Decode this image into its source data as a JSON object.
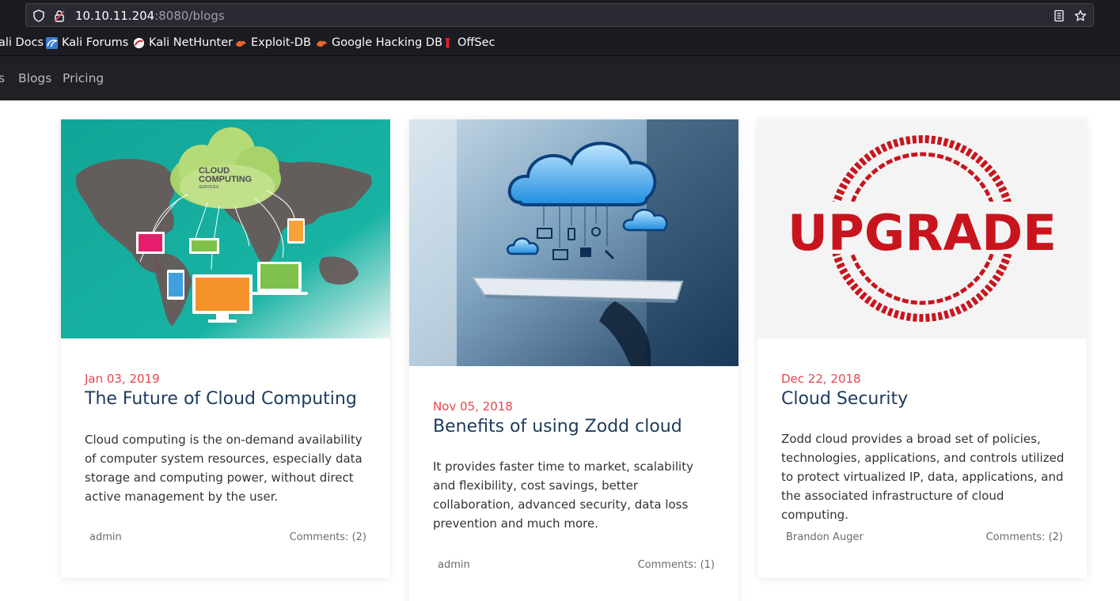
{
  "browser": {
    "url_host": "10.10.11.204",
    "url_path": ":8080/blogs",
    "bookmarks": [
      {
        "label": "ali Docs",
        "icon": "kali-icon"
      },
      {
        "label": "Kali Forums",
        "icon": "kali-icon"
      },
      {
        "label": "Kali NetHunter",
        "icon": "nethunter-icon"
      },
      {
        "label": "Exploit-DB",
        "icon": "exploitdb-icon"
      },
      {
        "label": "Google Hacking DB",
        "icon": "exploitdb-icon"
      },
      {
        "label": "OffSec",
        "icon": "offsec-icon"
      }
    ]
  },
  "nav": {
    "items": [
      {
        "label": "s"
      },
      {
        "label": "Blogs"
      },
      {
        "label": "Pricing"
      }
    ]
  },
  "posts": [
    {
      "image_text": [
        "CLOUD",
        "COMPUTING",
        "SERVICES"
      ],
      "date": "Jan 03, 2019",
      "title": "The Future of Cloud Computing",
      "excerpt": "Cloud computing is the on-demand availability of computer system resources, especially data storage and computing power, without direct active management by the user.",
      "author": "admin",
      "comments": "Comments: (2)"
    },
    {
      "date": "Nov 05, 2018",
      "title": "Benefits of using Zodd cloud",
      "excerpt": "It provides faster time to market, scalability and flexibility, cost savings, better collaboration, advanced security, data loss prevention and much more.",
      "author": "admin",
      "comments": "Comments: (1)"
    },
    {
      "image_text": "UPGRADE",
      "date": "Dec 22, 2018",
      "title": "Cloud Security",
      "excerpt": "Zodd cloud provides a broad set of policies, technologies, applications, and controls utilized to protect virtualized IP, data, applications, and the associated infrastructure of cloud computing.",
      "author": "Brandon Auger",
      "comments": "Comments: (2)"
    }
  ],
  "colors": {
    "date": "#e8454f",
    "title": "#1d3b5c",
    "nav_bg": "#202125",
    "chrome_bg": "#1c1b22"
  }
}
